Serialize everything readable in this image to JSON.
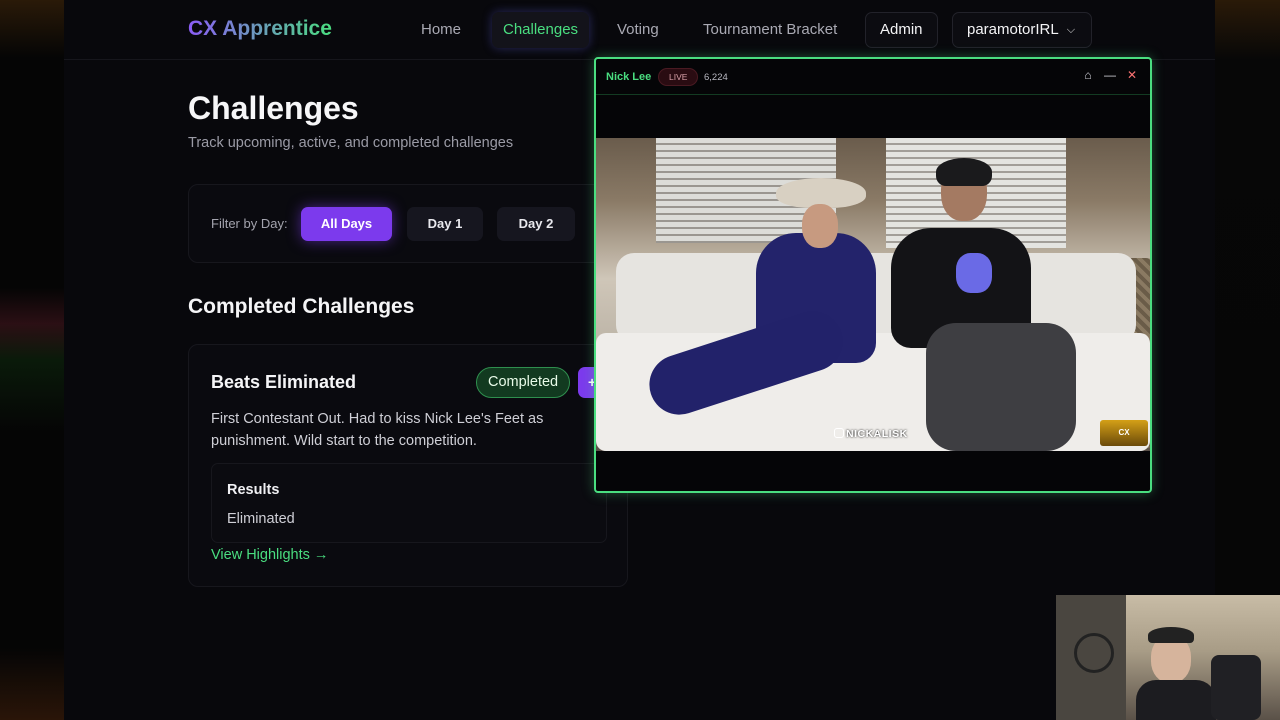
{
  "nav": {
    "brand": "CX Apprentice",
    "links": [
      "Home",
      "Challenges",
      "Voting",
      "Tournament Bracket"
    ],
    "admin": "Admin",
    "user": "paramotorIRL"
  },
  "page": {
    "title": "Challenges",
    "subtitle": "Track upcoming, active, and completed challenges"
  },
  "filter": {
    "label": "Filter by Day:",
    "options": [
      "All Days",
      "Day 1",
      "Day 2"
    ],
    "selected": "All Days"
  },
  "section": {
    "title": "Completed Challenges"
  },
  "challenge": {
    "title": "Beats Eliminated",
    "status": "Completed",
    "action": "+",
    "description": "First Contestant Out. Had to kiss Nick Lee's Feet as punishment. Wild start to the competition.",
    "results_label": "Results",
    "results_value": "Eliminated",
    "link": "View Highlights →"
  },
  "player": {
    "streamer": "Nick Lee",
    "live": "LIVE",
    "viewers": "6,224",
    "watermark": "NICKALISK",
    "controls": {
      "home_icon": "⌂",
      "minimize_icon": "—",
      "close_icon": "✕"
    }
  },
  "colors": {
    "accent_green": "#4ade80",
    "accent_purple": "#7c3aed",
    "background": "#08080c"
  }
}
